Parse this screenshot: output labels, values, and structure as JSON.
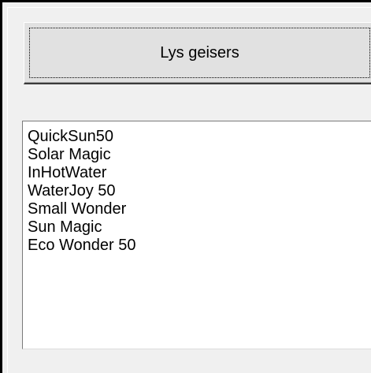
{
  "button": {
    "label": "Lys geisers"
  },
  "list": {
    "items": [
      "QuickSun50",
      "Solar Magic",
      "InHotWater",
      "WaterJoy 50",
      "Small Wonder",
      "Sun Magic",
      "Eco Wonder 50"
    ]
  }
}
